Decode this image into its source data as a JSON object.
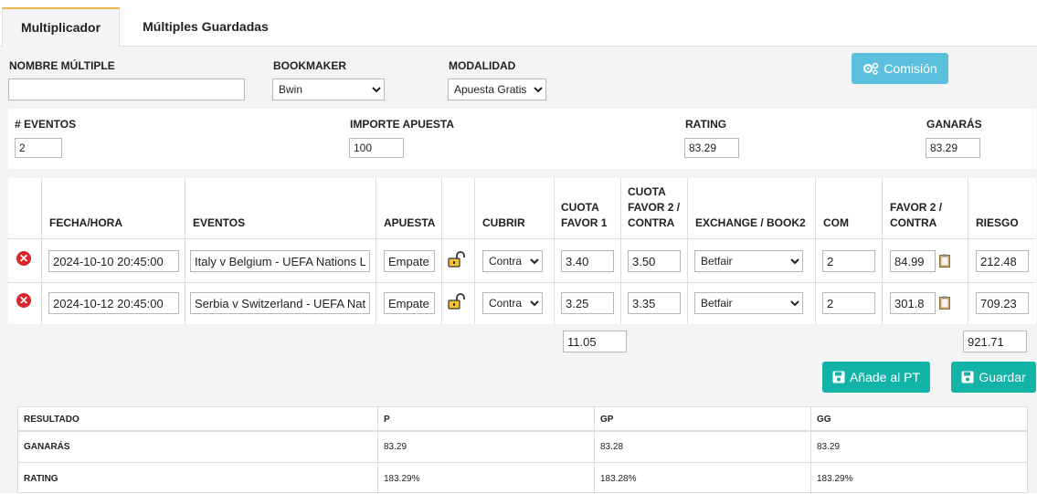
{
  "tabs": [
    {
      "label": "Multiplicador"
    },
    {
      "label": "Múltiples Guardadas"
    }
  ],
  "form": {
    "nombre_label": "NOMBRE MÚLTIPLE",
    "nombre_value": "",
    "bookmaker_label": "BOOKMAKER",
    "bookmaker_value": "Bwin",
    "modalidad_label": "MODALIDAD",
    "modalidad_value": "Apuesta Gratis",
    "comision_label": "Comisión"
  },
  "summary": {
    "eventos_label": "# EVENTOS",
    "eventos_value": "2",
    "importe_label": "IMPORTE APUESTA",
    "importe_value": "100",
    "rating_label": "RATING",
    "rating_value": "83.29",
    "ganaras_label": "GANARÁS",
    "ganaras_value": "83.29"
  },
  "table": {
    "headers": [
      "FECHA/HORA",
      "EVENTOS",
      "APUESTA",
      "CUBRIR",
      "CUOTA FAVOR 1",
      "CUOTA FAVOR 2 / CONTRA",
      "EXCHANGE / BOOK2",
      "COM",
      "FAVOR 2 / CONTRA",
      "RIESGO"
    ],
    "rows": [
      {
        "fecha": "2024-10-10 20:45:00",
        "evento": "Italy v Belgium - UEFA Nations League",
        "apuesta": "Empate",
        "cubrir": "Contra",
        "cuota1": "3.40",
        "cuota2": "3.50",
        "exchange": "Betfair",
        "com": "2",
        "favor2": "84.99",
        "riesgo": "212.48"
      },
      {
        "fecha": "2024-10-12 20:45:00",
        "evento": "Serbia v Switzerland - UEFA Nations League",
        "apuesta": "Empate",
        "cubrir": "Contra",
        "cuota1": "3.25",
        "cuota2": "3.35",
        "exchange": "Betfair",
        "com": "2",
        "favor2": "301.8",
        "riesgo": "709.23"
      }
    ],
    "total_cuota": "11.05",
    "total_riesgo": "921.71"
  },
  "actions": {
    "anade_label": "Añade al PT",
    "guardar_label": "Guardar"
  },
  "results": {
    "headers": [
      "RESULTADO",
      "P",
      "GP",
      "GG"
    ],
    "rows": [
      {
        "label": "GANARÁS",
        "p": "83.29",
        "gp": "83.28",
        "gg": "83.29"
      },
      {
        "label": "RATING",
        "p": "183.29%",
        "gp": "183.28%",
        "gg": "183.29%"
      }
    ]
  },
  "colors": {
    "accent_tab": "#e6b94a",
    "info_button": "#5bc0de",
    "teal_button": "#13b3a8",
    "delete": "#d9262c"
  }
}
